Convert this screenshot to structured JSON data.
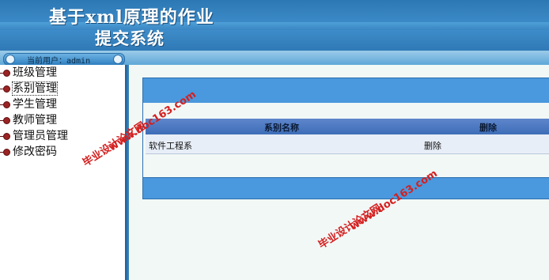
{
  "header": {
    "title_line1": "基于xml原理的作业",
    "title_line2": "提交系统"
  },
  "user": {
    "label": "当前用户：admin"
  },
  "sidebar": {
    "items": [
      {
        "label": "班级管理"
      },
      {
        "label": "系别管理"
      },
      {
        "label": "学生管理"
      },
      {
        "label": "教师管理"
      },
      {
        "label": "管理员管理"
      },
      {
        "label": "修改密码"
      }
    ],
    "selected_index": 1
  },
  "table": {
    "columns": [
      "系别名称",
      "删除"
    ],
    "rows": [
      {
        "name": "软件工程系",
        "action": "删除"
      }
    ]
  },
  "watermarks": {
    "cn": "毕业设计论文网",
    "url": "www.doc163.com"
  },
  "colors": {
    "header": "#3f8ecb",
    "panel": "#4a98dd",
    "table_header": "#4f7cc4",
    "watermark": "#d42020"
  }
}
